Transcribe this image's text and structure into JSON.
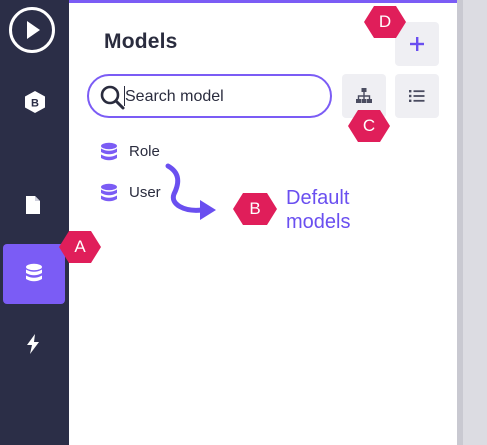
{
  "panel": {
    "title": "Models",
    "add_button_icon": "plus-icon",
    "diagram_button_icon": "diagram-icon",
    "list_button_icon": "list-icon"
  },
  "search": {
    "placeholder": "Search model",
    "value": ""
  },
  "models": [
    {
      "label": "Role",
      "icon": "database-icon"
    },
    {
      "label": "User",
      "icon": "database-icon"
    }
  ],
  "rail": {
    "brand_letter": "B",
    "items": [
      {
        "icon": "play-icon"
      },
      {
        "icon": "brand-hexagon-icon"
      },
      {
        "icon": "document-icon"
      },
      {
        "icon": "database-icon",
        "active": true
      },
      {
        "icon": "lightning-icon"
      }
    ]
  },
  "annotations": {
    "badge_a": "A",
    "badge_b": "B",
    "badge_c": "C",
    "badge_d": "D",
    "callout_text": "Default\nmodels"
  },
  "colors": {
    "accent": "#7b5cf5",
    "rail": "#2b2e47",
    "badge": "#e01e5a",
    "callout": "#6a4ff0"
  }
}
